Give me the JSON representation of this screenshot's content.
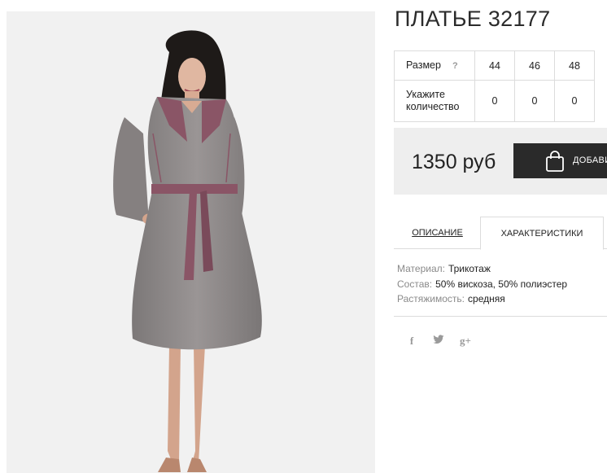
{
  "product": {
    "title": "ПЛАТЬЕ 32177",
    "image_alt": "Серое платье с поясом"
  },
  "sizes": {
    "size_label": "Размер",
    "help_icon": "?",
    "values": [
      "44",
      "46",
      "48"
    ],
    "qty_label": "Укажите количество",
    "quantities": [
      "0",
      "0",
      "0"
    ]
  },
  "purchase": {
    "price": "1350 руб",
    "add_button_label": "ДОБАВИТЬ"
  },
  "tabs": {
    "description": "ОПИСАНИЕ",
    "characteristics": "ХАРАКТЕРИСТИКИ",
    "active": "characteristics"
  },
  "specs": [
    {
      "key": "Материал:",
      "value": "Трикотаж"
    },
    {
      "key": "Состав:",
      "value": "50% вискоза, 50% полиэстер"
    },
    {
      "key": "Растяжимость:",
      "value": "средняя"
    }
  ],
  "social": {
    "facebook": "f",
    "twitter": "twitter-bird",
    "googleplus": "g+"
  },
  "colors": {
    "button_bg": "#2a2a2a",
    "price_panel_bg": "#eeeeee",
    "border": "#dcdcdc",
    "dress_gray": "#8e8a8a",
    "trim_mauve": "#8a5566"
  }
}
